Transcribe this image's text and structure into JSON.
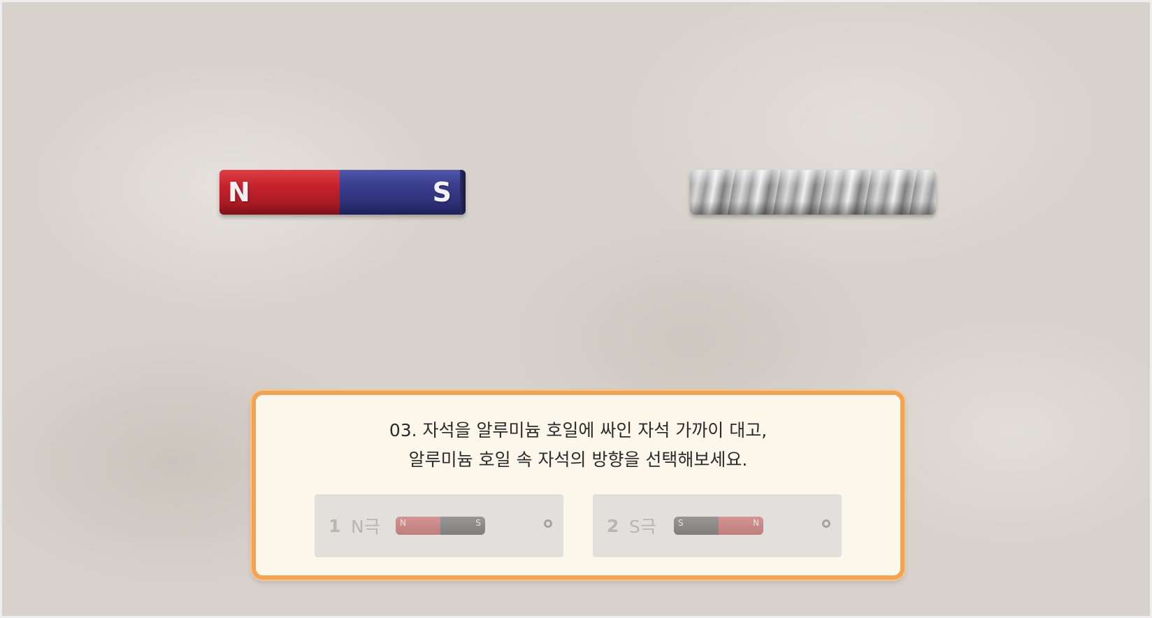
{
  "magnet": {
    "north_label": "N",
    "south_label": "S",
    "colors": {
      "north": "#c8222d",
      "south": "#3a3d8e"
    }
  },
  "foil_magnet": {
    "icon": "foil-wrapped-magnet"
  },
  "question": {
    "line1": "03. 자석을 알루미늄 호일에 싸인 자석 가까이 대고,",
    "line2": "알루미늄 호일 속 자석의 방향을 선택해보세요."
  },
  "options": [
    {
      "number": "1",
      "label": "N극",
      "icon": "magnet-red-left-icon",
      "left_glyph": "N",
      "right_glyph": "S"
    },
    {
      "number": "2",
      "label": "S극",
      "icon": "magnet-red-right-icon",
      "left_glyph": "S",
      "right_glyph": "N"
    }
  ],
  "accent_color": "#f0a454"
}
